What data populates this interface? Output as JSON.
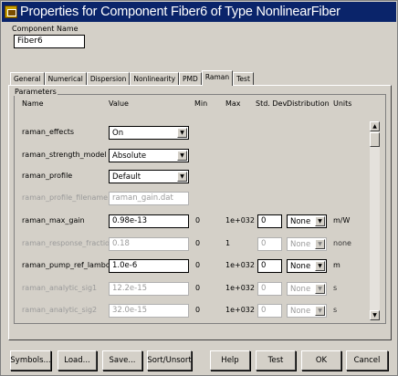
{
  "window": {
    "title": "Properties for Component Fiber6 of Type NonlinearFiber"
  },
  "component": {
    "name_label": "Component Name",
    "name_value": "Fiber6"
  },
  "tabs": [
    {
      "label": "General"
    },
    {
      "label": "Numerical"
    },
    {
      "label": "Dispersion"
    },
    {
      "label": "Nonlinearity"
    },
    {
      "label": "PMD"
    },
    {
      "label": "Raman",
      "active": true
    },
    {
      "label": "Test"
    }
  ],
  "parameters": {
    "group_label": "Parameters",
    "headers": {
      "name": "Name",
      "value": "Value",
      "min": "Min",
      "max": "Max",
      "std_dev": "Std. Dev.",
      "distribution": "Distribution",
      "units": "Units"
    },
    "rows": [
      {
        "name": "raman_effects",
        "value": "On",
        "enabled": true
      },
      {
        "name": "raman_strength_model",
        "value": "Absolute",
        "enabled": true
      },
      {
        "name": "raman_profile",
        "value": "Default",
        "enabled": true
      },
      {
        "name": "raman_profile_filename",
        "value": "raman_gain.dat",
        "enabled": false
      },
      {
        "name": "raman_max_gain",
        "value": "0.98e-13",
        "min": "0",
        "max": "1e+032",
        "std_dev": "0",
        "distribution": "None",
        "units": "m/W",
        "enabled": true
      },
      {
        "name": "raman_response_fraction",
        "value": "0.18",
        "min": "0",
        "max": "1",
        "std_dev": "0",
        "distribution": "None",
        "units": "none",
        "enabled": false
      },
      {
        "name": "raman_pump_ref_lambda",
        "value": "1.0e-6",
        "min": "0",
        "max": "1e+032",
        "std_dev": "0",
        "distribution": "None",
        "units": "m",
        "enabled": true
      },
      {
        "name": "raman_analytic_sig1",
        "value": "12.2e-15",
        "min": "0",
        "max": "1e+032",
        "std_dev": "0",
        "distribution": "None",
        "units": "s",
        "enabled": false
      },
      {
        "name": "raman_analytic_sig2",
        "value": "32.0e-15",
        "min": "0",
        "max": "1e+032",
        "std_dev": "0",
        "distribution": "None",
        "units": "s",
        "enabled": false
      }
    ]
  },
  "buttons": {
    "symbols": "Symbols...",
    "load": "Load...",
    "save": "Save...",
    "sort": "Sort/Unsort",
    "help": "Help",
    "test": "Test",
    "ok": "OK",
    "cancel": "Cancel"
  }
}
